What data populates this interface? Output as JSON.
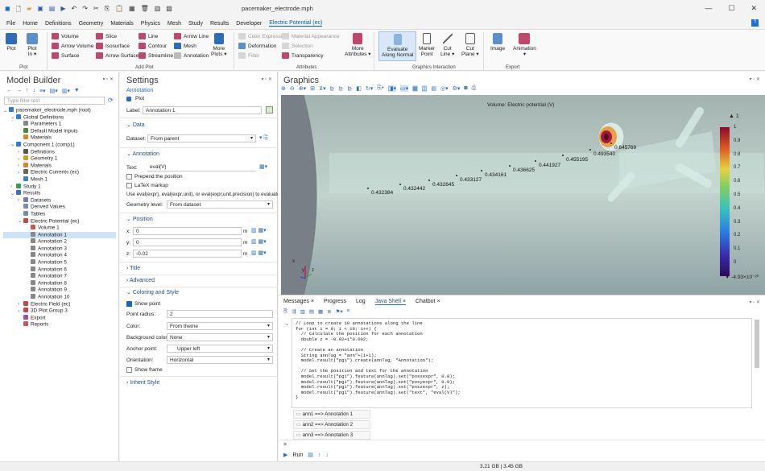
{
  "window": {
    "title": "pacemaker_electrode.mph",
    "minimize": "—",
    "restore": "☐",
    "close": "✕"
  },
  "menu": [
    "File",
    "Home",
    "Definitions",
    "Geometry",
    "Materials",
    "Physics",
    "Mesh",
    "Study",
    "Results",
    "Developer",
    "Electric Potential (ec)"
  ],
  "help_label": "?",
  "ribbon": {
    "plot": {
      "plot": "Plot",
      "plot_in": "Plot\nIn ▾",
      "group": "Plot"
    },
    "add_plot": {
      "volume": "Volume",
      "arrow_volume": "Arrow Volume",
      "surface": "Surface",
      "slice": "Slice",
      "isosurface": "Isosurface",
      "arrow_surface": "Arrow Surface",
      "line": "Line",
      "contour": "Contour",
      "streamline": "Streamline",
      "arrow_line": "Arrow Line",
      "mesh": "Mesh",
      "annotation": "Annotation",
      "more_plots": "More\nPlots ▾",
      "group": "Add Plot"
    },
    "attributes": {
      "color_expression": "Color Expression",
      "deformation": "Deformation",
      "filter": "Filter",
      "material_appearance": "Material Appearance",
      "selection": "Selection",
      "transparency": "Transparency",
      "more_attributes": "More\nAttributes ▾",
      "group": "Attributes"
    },
    "graphics_interaction": {
      "evaluate": "Evaluate\nAlong Normal",
      "marker_point": "Marker\nPoint",
      "cut_line": "Cut\nLine ▾",
      "cut_plane": "Cut\nPlane ▾",
      "group": "Graphics Interaction"
    },
    "export": {
      "image": "Image",
      "animation": "Animation\n▾",
      "group": "Export"
    }
  },
  "model_builder": {
    "title": "Model Builder",
    "filter_placeholder": "Type filter text",
    "tree": [
      {
        "label": "pacemaker_electrode.mph (root)",
        "indent": 0,
        "arrow": "v",
        "color": "#2a7fd4"
      },
      {
        "label": "Global Definitions",
        "indent": 1,
        "arrow": "v",
        "color": "#2a7fd4"
      },
      {
        "label": "Parameters 1",
        "indent": 2,
        "arrow": "",
        "color": "#888"
      },
      {
        "label": "Default Model Inputs",
        "indent": 2,
        "arrow": "",
        "color": "#4a8a3a"
      },
      {
        "label": "Materials",
        "indent": 2,
        "arrow": "",
        "color": "#d08a2a"
      },
      {
        "label": "Component 1 (comp1)",
        "indent": 1,
        "arrow": "v",
        "color": "#2a7fd4"
      },
      {
        "label": "Definitions",
        "indent": 2,
        "arrow": ">",
        "color": "#555"
      },
      {
        "label": "Geometry 1",
        "indent": 2,
        "arrow": ">",
        "color": "#d09a2a"
      },
      {
        "label": "Materials",
        "indent": 2,
        "arrow": ">",
        "color": "#d08a2a"
      },
      {
        "label": "Electric Currents (ec)",
        "indent": 2,
        "arrow": ">",
        "color": "#666"
      },
      {
        "label": "Mesh 1",
        "indent": 2,
        "arrow": "",
        "color": "#3a7fbf"
      },
      {
        "label": "Study 1",
        "indent": 1,
        "arrow": ">",
        "color": "#3a9a5a"
      },
      {
        "label": "Results",
        "indent": 1,
        "arrow": "v",
        "color": "#3a6fbf"
      },
      {
        "label": "Datasets",
        "indent": 2,
        "arrow": ">",
        "color": "#7a7aaa"
      },
      {
        "label": "Derived Values",
        "indent": 2,
        "arrow": "",
        "color": "#7a8aaa"
      },
      {
        "label": "Tables",
        "indent": 2,
        "arrow": "",
        "color": "#7a8aaa"
      },
      {
        "label": "Electric Potential (ec)",
        "indent": 2,
        "arrow": "v",
        "color": "#c04a4a"
      },
      {
        "label": "Volume 1",
        "indent": 3,
        "arrow": "",
        "color": "#c05a5a"
      },
      {
        "label": "Annotation 1",
        "indent": 3,
        "arrow": "",
        "color": "#888",
        "selected": true
      },
      {
        "label": "Annotation 2",
        "indent": 3,
        "arrow": "",
        "color": "#888"
      },
      {
        "label": "Annotation 3",
        "indent": 3,
        "arrow": "",
        "color": "#888"
      },
      {
        "label": "Annotation 4",
        "indent": 3,
        "arrow": "",
        "color": "#888"
      },
      {
        "label": "Annotation 5",
        "indent": 3,
        "arrow": "",
        "color": "#888"
      },
      {
        "label": "Annotation 6",
        "indent": 3,
        "arrow": "",
        "color": "#888"
      },
      {
        "label": "Annotation 7",
        "indent": 3,
        "arrow": "",
        "color": "#888"
      },
      {
        "label": "Annotation 8",
        "indent": 3,
        "arrow": "",
        "color": "#888"
      },
      {
        "label": "Annotation 9",
        "indent": 3,
        "arrow": "",
        "color": "#888"
      },
      {
        "label": "Annotation 10",
        "indent": 3,
        "arrow": "",
        "color": "#888"
      },
      {
        "label": "Electric Field (ec)",
        "indent": 2,
        "arrow": ">",
        "color": "#c04a4a"
      },
      {
        "label": "3D Plot Group 3",
        "indent": 2,
        "arrow": ">",
        "color": "#c04a4a"
      },
      {
        "label": "Export",
        "indent": 2,
        "arrow": "",
        "color": "#8a5aa8"
      },
      {
        "label": "Reports",
        "indent": 2,
        "arrow": "",
        "color": "#c05a5a"
      }
    ]
  },
  "settings": {
    "title": "Settings",
    "subtitle": "Annotation",
    "plot_btn": "Plot",
    "label_caption": "Label:",
    "label_value": "Annotation 1",
    "sec_data": "Data",
    "dataset_caption": "Dataset:",
    "dataset_value": "From parent",
    "sec_annotation": "Annotation",
    "text_caption": "Text:",
    "text_value": "eval(V)",
    "prepend": "Prepend the position",
    "latex": "LaTeX markup",
    "eval_hint": "Use eval(expr), eval(expr,unit), or eval(expr,unit,precision) to evaluate ar",
    "geom_level_caption": "Geometry level:",
    "geom_level_value": "From dataset",
    "sec_position": "Position",
    "x_caption": "x:",
    "x_value": "0",
    "y_caption": "y:",
    "y_value": "0",
    "z_caption": "z:",
    "z_value": "-0.02",
    "unit": "m",
    "sec_title": "Title",
    "sec_advanced": "Advanced",
    "sec_coloring": "Coloring and Style",
    "show_point": "Show point",
    "point_radius_caption": "Point radius:",
    "point_radius_value": "2",
    "color_caption": "Color:",
    "color_value": "From theme",
    "bg_caption": "Background color:",
    "bg_value": "None",
    "anchor_caption": "Anchor point:",
    "anchor_value": "Upper left",
    "orientation_caption": "Orientation:",
    "orientation_value": "Horizontal",
    "show_frame": "Show frame",
    "sec_inherit": "Inherit Style"
  },
  "graphics": {
    "title": "Graphics",
    "plot_title": "Volume: Electric potential (V)",
    "annotations": [
      "0.432384",
      "0.432442",
      "0.432645",
      "0.433127",
      "0.434161",
      "0.436625",
      "0.441927",
      "0.455195",
      "0.493540",
      "0.645769"
    ],
    "colorbar_ticks": [
      "1",
      "0.9",
      "0.8",
      "0.7",
      "0.6",
      "0.5",
      "0.4",
      "0.3",
      "0.2",
      "0.1",
      "0"
    ],
    "colorbar_max": "▲ 1",
    "colorbar_min": "▼ -4.93×10⁻²⁰",
    "axis_x": "x",
    "axis_y": "y",
    "axis_z": "z"
  },
  "bottom": {
    "tabs": [
      "Messages ×",
      "Progress",
      "Log",
      "Java Shell ×",
      "Chatbot ×"
    ],
    "active_tab": "Java Shell ×",
    "code": "// Loop to create 10 annotations along the line\nfor (int i = 0; i < 10; i++) {\n  // Calculate the position for each annotation\n  double z = -0.02+i*0.002;\n\n  // Create an annotation\n  String annTag = \"ann\"+(i+1);\n  model.result(\"pg1\").create(annTag, \"Annotation\");\n\n  // Set the position and text for the annotation\n  model.result(\"pg1\").feature(annTag).set(\"posxexpr\", 0.0);\n  model.result(\"pg1\").feature(annTag).set(\"posyexpr\", 0.0);\n  model.result(\"pg1\").feature(annTag).set(\"poszexpr\", z);\n  model.result(\"pg1\").feature(annTag).set(\"text\", \"eval(V)\");\n}",
    "outputs": [
      "ann1 ==> Annotation 1",
      "ann2 ==> Annotation 2",
      "ann3 ==> Annotation 3"
    ],
    "prompt": ">",
    "run": "Run"
  },
  "status": {
    "memory": "3.21 GB | 3.45 GB"
  }
}
